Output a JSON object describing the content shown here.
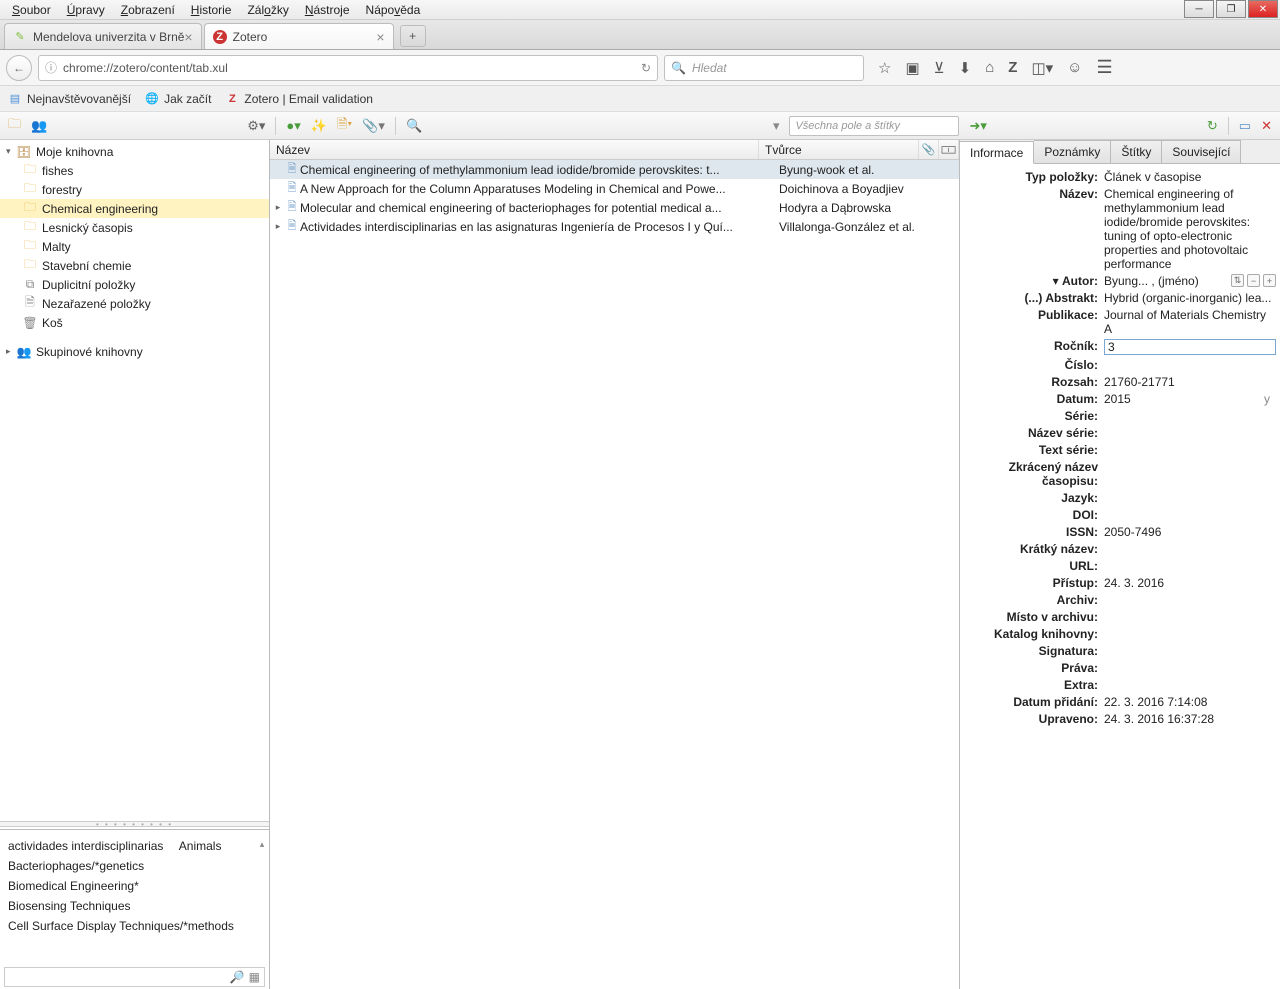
{
  "menus": [
    "Soubor",
    "Úpravy",
    "Zobrazení",
    "Historie",
    "Záložky",
    "Nástroje",
    "Nápověda"
  ],
  "tabs": [
    {
      "label": "Mendelova univerzita v Brně",
      "active": false
    },
    {
      "label": "Zotero",
      "active": true
    }
  ],
  "url": "chrome://zotero/content/tab.xul",
  "search_placeholder": "Hledat",
  "bookmarks": [
    {
      "label": "Nejnavštěvovanější"
    },
    {
      "label": "Jak začít"
    },
    {
      "label": "Zotero | Email validation"
    }
  ],
  "zotero_search_placeholder": "Všechna pole a štítky",
  "library": {
    "root": "Moje knihovna",
    "collections": [
      "fishes",
      "forestry",
      "Chemical engineering",
      "Lesnický časopis",
      "Malty",
      "Stavební chemie"
    ],
    "selected": "Chemical engineering",
    "special": [
      "Duplicitní položky",
      "Nezařazené položky",
      "Koš"
    ],
    "group": "Skupinové knihovny"
  },
  "columns": {
    "title": "Název",
    "creator": "Tvůrce"
  },
  "items": [
    {
      "title": "Chemical engineering of methylammonium lead iodide/bromide perovskites: t...",
      "creator": "Byung-wook et al.",
      "selected": true,
      "expand": false
    },
    {
      "title": "A New Approach for the Column Apparatuses Modeling in Chemical and Powe...",
      "creator": "Doichinova a Boyadjiev",
      "expand": false
    },
    {
      "title": "Molecular and chemical engineering of bacteriophages for potential medical a...",
      "creator": "Hodyra a Dąbrowska",
      "expand": true
    },
    {
      "title": "Actividades interdisciplinarias en las asignaturas Ingeniería de Procesos I y Quí...",
      "creator": "Villalonga-González et al.",
      "expand": true
    }
  ],
  "tags": [
    "actividades interdisciplinarias",
    "Animals",
    "Bacteriophages/*genetics",
    "Biomedical Engineering*",
    "Biosensing Techniques",
    "Cell Surface Display Techniques/*methods"
  ],
  "info_tabs": [
    "Informace",
    "Poznámky",
    "Štítky",
    "Související"
  ],
  "info": {
    "fields": [
      {
        "label": "Typ položky:",
        "value": "Článek v časopise"
      },
      {
        "label": "Název:",
        "value": "Chemical engineering of methylammonium lead iodide/bromide perovskites: tuning of opto-electronic properties and photovoltaic performance"
      },
      {
        "label": "Autor:",
        "value": "Byung... , (jméno)",
        "author": true,
        "twisty": true
      },
      {
        "label": "(...) Abstrakt:",
        "value": "Hybrid (organic-inorganic) lea..."
      },
      {
        "label": "Publikace:",
        "value": "Journal of Materials Chemistry A"
      },
      {
        "label": "Ročník:",
        "value": "3",
        "editing": true
      },
      {
        "label": "Číslo:",
        "value": ""
      },
      {
        "label": "Rozsah:",
        "value": "21760-21771"
      },
      {
        "label": "Datum:",
        "value": "2015",
        "suffix": "y"
      },
      {
        "label": "Série:",
        "value": ""
      },
      {
        "label": "Název série:",
        "value": ""
      },
      {
        "label": "Text série:",
        "value": ""
      },
      {
        "label": "Zkrácený název časopisu:",
        "value": ""
      },
      {
        "label": "Jazyk:",
        "value": ""
      },
      {
        "label": "DOI:",
        "value": ""
      },
      {
        "label": "ISSN:",
        "value": "2050-7496"
      },
      {
        "label": "Krátký název:",
        "value": ""
      },
      {
        "label": "URL:",
        "value": ""
      },
      {
        "label": "Přístup:",
        "value": "24. 3. 2016"
      },
      {
        "label": "Archiv:",
        "value": ""
      },
      {
        "label": "Místo v archivu:",
        "value": ""
      },
      {
        "label": "Katalog knihovny:",
        "value": ""
      },
      {
        "label": "Signatura:",
        "value": ""
      },
      {
        "label": "Práva:",
        "value": ""
      },
      {
        "label": "Extra:",
        "value": ""
      },
      {
        "label": "Datum přidání:",
        "value": "22. 3. 2016 7:14:08"
      },
      {
        "label": "Upraveno:",
        "value": "24. 3. 2016 16:37:28"
      }
    ]
  }
}
